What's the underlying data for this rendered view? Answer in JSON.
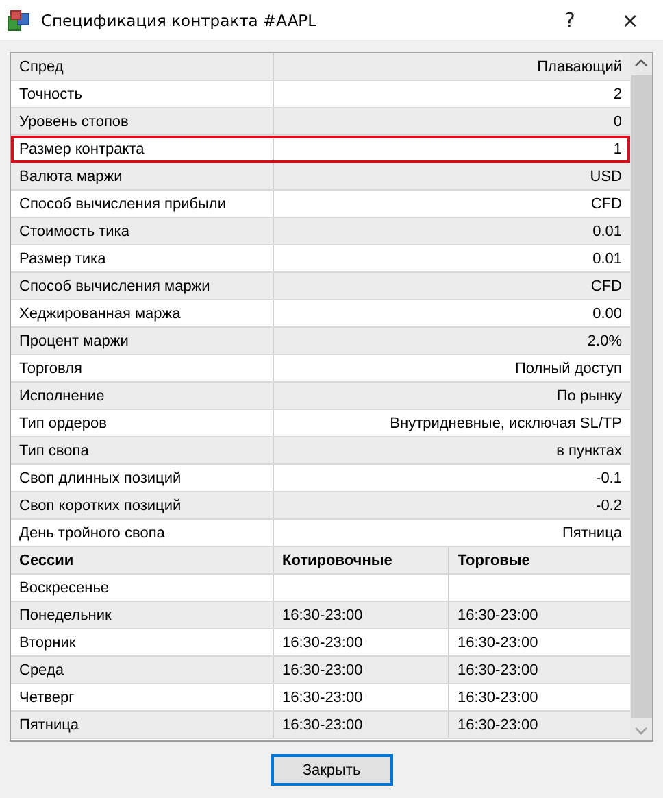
{
  "window": {
    "title": "Спецификация контракта #AAPL",
    "help": "?",
    "close": "×"
  },
  "properties": [
    {
      "name": "Спред",
      "value": "Плавающий",
      "highlighted": false
    },
    {
      "name": "Точность",
      "value": "2",
      "highlighted": false
    },
    {
      "name": "Уровень стопов",
      "value": "0",
      "highlighted": false
    },
    {
      "name": "Размер контракта",
      "value": "1",
      "highlighted": true
    },
    {
      "name": "Валюта маржи",
      "value": "USD",
      "highlighted": false
    },
    {
      "name": "Способ вычисления прибыли",
      "value": "CFD",
      "highlighted": false
    },
    {
      "name": "Стоимость тика",
      "value": "0.01",
      "highlighted": false
    },
    {
      "name": "Размер тика",
      "value": "0.01",
      "highlighted": false
    },
    {
      "name": "Способ вычисления маржи",
      "value": "CFD",
      "highlighted": false
    },
    {
      "name": "Хеджированная маржа",
      "value": "0.00",
      "highlighted": false
    },
    {
      "name": "Процент маржи",
      "value": "2.0%",
      "highlighted": false
    },
    {
      "name": "Торговля",
      "value": "Полный доступ",
      "highlighted": false
    },
    {
      "name": "Исполнение",
      "value": "По рынку",
      "highlighted": false
    },
    {
      "name": "Тип ордеров",
      "value": "Внутридневные, исключая SL/TP",
      "highlighted": false
    },
    {
      "name": "Тип свопа",
      "value": "в пунктах",
      "highlighted": false
    },
    {
      "name": "Своп длинных позиций",
      "value": "-0.1",
      "highlighted": false
    },
    {
      "name": "Своп коротких позиций",
      "value": "-0.2",
      "highlighted": false
    },
    {
      "name": "День тройного свопа",
      "value": "Пятница",
      "highlighted": false
    }
  ],
  "sessions": {
    "columns": [
      "Сессии",
      "Котировочные",
      "Торговые"
    ],
    "rows": [
      {
        "day": "Воскресенье"
      },
      {
        "day": "Понедельник",
        "quotes": "16:30-23:00",
        "trades": "16:30-23:00"
      },
      {
        "day": "Вторник",
        "quotes": "16:30-23:00",
        "trades": "16:30-23:00"
      },
      {
        "day": "Среда",
        "quotes": "16:30-23:00",
        "trades": "16:30-23:00"
      },
      {
        "day": "Четверг",
        "quotes": "16:30-23:00",
        "trades": "16:30-23:00"
      },
      {
        "day": "Пятница",
        "quotes": "16:30-23:00",
        "trades": "16:30-23:00"
      }
    ]
  },
  "buttons": [
    "Закрыть"
  ]
}
